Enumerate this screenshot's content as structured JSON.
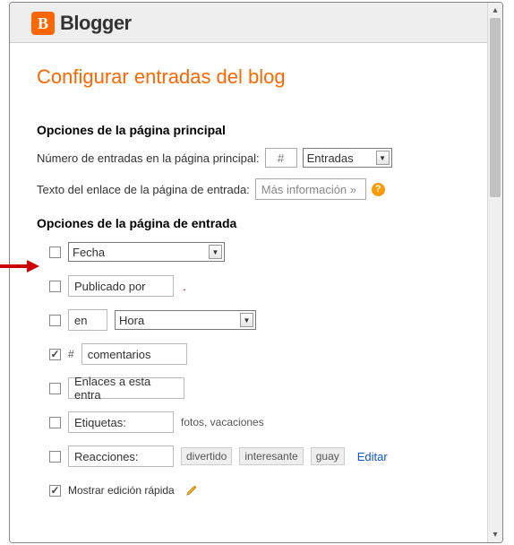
{
  "header": {
    "brand": "Blogger"
  },
  "page": {
    "title": "Configurar entradas del blog"
  },
  "mainOptions": {
    "heading": "Opciones de la página principal",
    "numLabel": "Número de entradas en la página principal:",
    "numPlaceholder": "#",
    "entriesSelect": "Entradas",
    "linkTextLabel": "Texto del enlace de la página de entrada:",
    "linkTextValue": "Más información »"
  },
  "entryOptions": {
    "heading": "Opciones de la página de entrada",
    "items": {
      "fecha": {
        "checked": false,
        "select": "Fecha"
      },
      "publicado": {
        "checked": false,
        "value": "Publicado por"
      },
      "hora": {
        "checked": false,
        "en": "en",
        "select": "Hora"
      },
      "comentarios": {
        "checked": true,
        "hash": "#",
        "value": "comentarios"
      },
      "enlaces": {
        "checked": false,
        "value": "Enlaces a esta entra"
      },
      "etiquetas": {
        "checked": false,
        "value": "Etiquetas:",
        "example": "fotos, vacaciones"
      },
      "reacciones": {
        "checked": false,
        "value": "Reacciones:",
        "tags": [
          "divertido",
          "interesante",
          "guay"
        ],
        "edit": "Editar"
      },
      "quickedit": {
        "checked": true,
        "label": "Mostrar edición rápida"
      }
    }
  }
}
